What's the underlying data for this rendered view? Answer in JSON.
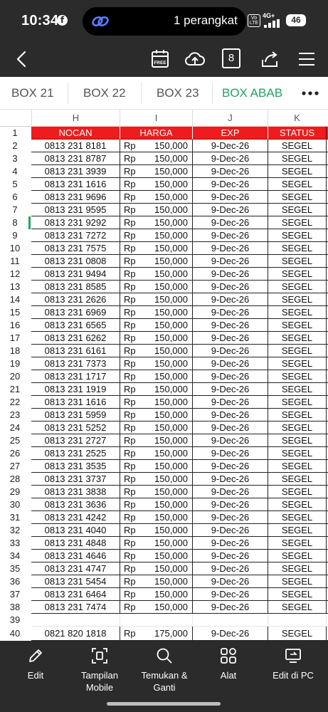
{
  "status_bar": {
    "time": "10:34",
    "island_text": "1 perangkat",
    "volte": "Vo LTE",
    "network": "4G+",
    "battery": "46"
  },
  "toolbar": {
    "page_number": "8",
    "free_badge": "FREE",
    "icons": [
      "back-arrow-icon",
      "calendar-free-icon",
      "cloud-upload-icon",
      "page-count-icon",
      "share-icon",
      "menu-icon"
    ]
  },
  "tabs": [
    {
      "label": "BOX 21",
      "active": false
    },
    {
      "label": "BOX 22",
      "active": false
    },
    {
      "label": "BOX 23",
      "active": false
    },
    {
      "label": "BOX ABAB",
      "active": true
    }
  ],
  "accent_color": "#1fa463",
  "header_color": "#ee1c1c",
  "sheet": {
    "columns": [
      "H",
      "I",
      "J",
      "K"
    ],
    "header_row": {
      "num": "1",
      "cells": [
        "NOCAN",
        "HARGA",
        "EXP",
        "STATUS"
      ]
    },
    "rows": [
      {
        "num": "2",
        "nocan": "0813 231 8181",
        "currency": "Rp",
        "price": "150,000",
        "exp": "9-Dec-26",
        "status": "SEGEL"
      },
      {
        "num": "3",
        "nocan": "0813 231 8787",
        "currency": "Rp",
        "price": "150,000",
        "exp": "9-Dec-26",
        "status": "SEGEL"
      },
      {
        "num": "4",
        "nocan": "0813 231 3939",
        "currency": "Rp",
        "price": "150,000",
        "exp": "9-Dec-26",
        "status": "SEGEL"
      },
      {
        "num": "5",
        "nocan": "0813 231 1616",
        "currency": "Rp",
        "price": "150,000",
        "exp": "9-Dec-26",
        "status": "SEGEL"
      },
      {
        "num": "6",
        "nocan": "0813 231 9696",
        "currency": "Rp",
        "price": "150,000",
        "exp": "9-Dec-26",
        "status": "SEGEL"
      },
      {
        "num": "7",
        "nocan": "0813 231 9595",
        "currency": "Rp",
        "price": "150,000",
        "exp": "9-Dec-26",
        "status": "SEGEL"
      },
      {
        "num": "8",
        "nocan": "0813 231 9292",
        "currency": "Rp",
        "price": "150,000",
        "exp": "9-Dec-26",
        "status": "SEGEL"
      },
      {
        "num": "9",
        "nocan": "0813 231 7272",
        "currency": "Rp",
        "price": "150,000",
        "exp": "9-Dec-26",
        "status": "SEGEL"
      },
      {
        "num": "10",
        "nocan": "0813 231 7575",
        "currency": "Rp",
        "price": "150,000",
        "exp": "9-Dec-26",
        "status": "SEGEL"
      },
      {
        "num": "11",
        "nocan": "0813 231 0808",
        "currency": "Rp",
        "price": "150,000",
        "exp": "9-Dec-26",
        "status": "SEGEL"
      },
      {
        "num": "12",
        "nocan": "0813 231 9494",
        "currency": "Rp",
        "price": "150,000",
        "exp": "9-Dec-26",
        "status": "SEGEL"
      },
      {
        "num": "13",
        "nocan": "0813 231 8585",
        "currency": "Rp",
        "price": "150,000",
        "exp": "9-Dec-26",
        "status": "SEGEL"
      },
      {
        "num": "14",
        "nocan": "0813 231 2626",
        "currency": "Rp",
        "price": "150,000",
        "exp": "9-Dec-26",
        "status": "SEGEL"
      },
      {
        "num": "15",
        "nocan": "0813 231 6969",
        "currency": "Rp",
        "price": "150,000",
        "exp": "9-Dec-26",
        "status": "SEGEL"
      },
      {
        "num": "16",
        "nocan": "0813 231 6565",
        "currency": "Rp",
        "price": "150,000",
        "exp": "9-Dec-26",
        "status": "SEGEL"
      },
      {
        "num": "17",
        "nocan": "0813 231 6262",
        "currency": "Rp",
        "price": "150,000",
        "exp": "9-Dec-26",
        "status": "SEGEL"
      },
      {
        "num": "18",
        "nocan": "0813 231 6161",
        "currency": "Rp",
        "price": "150,000",
        "exp": "9-Dec-26",
        "status": "SEGEL"
      },
      {
        "num": "19",
        "nocan": "0813 231 7373",
        "currency": "Rp",
        "price": "150,000",
        "exp": "9-Dec-26",
        "status": "SEGEL"
      },
      {
        "num": "20",
        "nocan": "0813 231 1717",
        "currency": "Rp",
        "price": "150,000",
        "exp": "9-Dec-26",
        "status": "SEGEL"
      },
      {
        "num": "21",
        "nocan": "0813 231 1919",
        "currency": "Rp",
        "price": "150,000",
        "exp": "9-Dec-26",
        "status": "SEGEL"
      },
      {
        "num": "22",
        "nocan": "0813 231 1616",
        "currency": "Rp",
        "price": "150,000",
        "exp": "9-Dec-26",
        "status": "SEGEL"
      },
      {
        "num": "23",
        "nocan": "0813 231 5959",
        "currency": "Rp",
        "price": "150,000",
        "exp": "9-Dec-26",
        "status": "SEGEL"
      },
      {
        "num": "24",
        "nocan": "0813 231 5252",
        "currency": "Rp",
        "price": "150,000",
        "exp": "9-Dec-26",
        "status": "SEGEL"
      },
      {
        "num": "25",
        "nocan": "0813 231 2727",
        "currency": "Rp",
        "price": "150,000",
        "exp": "9-Dec-26",
        "status": "SEGEL"
      },
      {
        "num": "26",
        "nocan": "0813 231 2525",
        "currency": "Rp",
        "price": "150,000",
        "exp": "9-Dec-26",
        "status": "SEGEL"
      },
      {
        "num": "27",
        "nocan": "0813 231 3535",
        "currency": "Rp",
        "price": "150,000",
        "exp": "9-Dec-26",
        "status": "SEGEL"
      },
      {
        "num": "28",
        "nocan": "0813 231 3737",
        "currency": "Rp",
        "price": "150,000",
        "exp": "9-Dec-26",
        "status": "SEGEL"
      },
      {
        "num": "29",
        "nocan": "0813 231 3838",
        "currency": "Rp",
        "price": "150,000",
        "exp": "9-Dec-26",
        "status": "SEGEL"
      },
      {
        "num": "30",
        "nocan": "0813 231 3636",
        "currency": "Rp",
        "price": "150,000",
        "exp": "9-Dec-26",
        "status": "SEGEL"
      },
      {
        "num": "31",
        "nocan": "0813 231 4242",
        "currency": "Rp",
        "price": "150,000",
        "exp": "9-Dec-26",
        "status": "SEGEL"
      },
      {
        "num": "32",
        "nocan": "0813 231 4040",
        "currency": "Rp",
        "price": "150,000",
        "exp": "9-Dec-26",
        "status": "SEGEL"
      },
      {
        "num": "33",
        "nocan": "0813 231 4848",
        "currency": "Rp",
        "price": "150,000",
        "exp": "9-Dec-26",
        "status": "SEGEL"
      },
      {
        "num": "34",
        "nocan": "0813 231 4646",
        "currency": "Rp",
        "price": "150,000",
        "exp": "9-Dec-26",
        "status": "SEGEL"
      },
      {
        "num": "35",
        "nocan": "0813 231 4747",
        "currency": "Rp",
        "price": "150,000",
        "exp": "9-Dec-26",
        "status": "SEGEL"
      },
      {
        "num": "36",
        "nocan": "0813 231 5454",
        "currency": "Rp",
        "price": "150,000",
        "exp": "9-Dec-26",
        "status": "SEGEL"
      },
      {
        "num": "37",
        "nocan": "0813 231 6464",
        "currency": "Rp",
        "price": "150,000",
        "exp": "9-Dec-26",
        "status": "SEGEL"
      },
      {
        "num": "38",
        "nocan": "0813 231 7474",
        "currency": "Rp",
        "price": "150,000",
        "exp": "9-Dec-26",
        "status": "SEGEL"
      },
      {
        "num": "39",
        "nocan": "",
        "currency": "",
        "price": "",
        "exp": "",
        "status": ""
      },
      {
        "num": "40",
        "nocan": "0821 820 1818",
        "currency": "Rp",
        "price": "175,000",
        "exp": "9-Dec-26",
        "status": "SEGEL"
      }
    ]
  },
  "bottom_bar": [
    {
      "label": "Edit",
      "icon": "pencil-icon"
    },
    {
      "label": "Tampilan Mobile",
      "icon": "mobile-view-icon"
    },
    {
      "label": "Temukan & Ganti",
      "icon": "search-icon"
    },
    {
      "label": "Alat",
      "icon": "tools-icon"
    },
    {
      "label": "Edit di PC",
      "icon": "edit-on-pc-icon"
    }
  ]
}
